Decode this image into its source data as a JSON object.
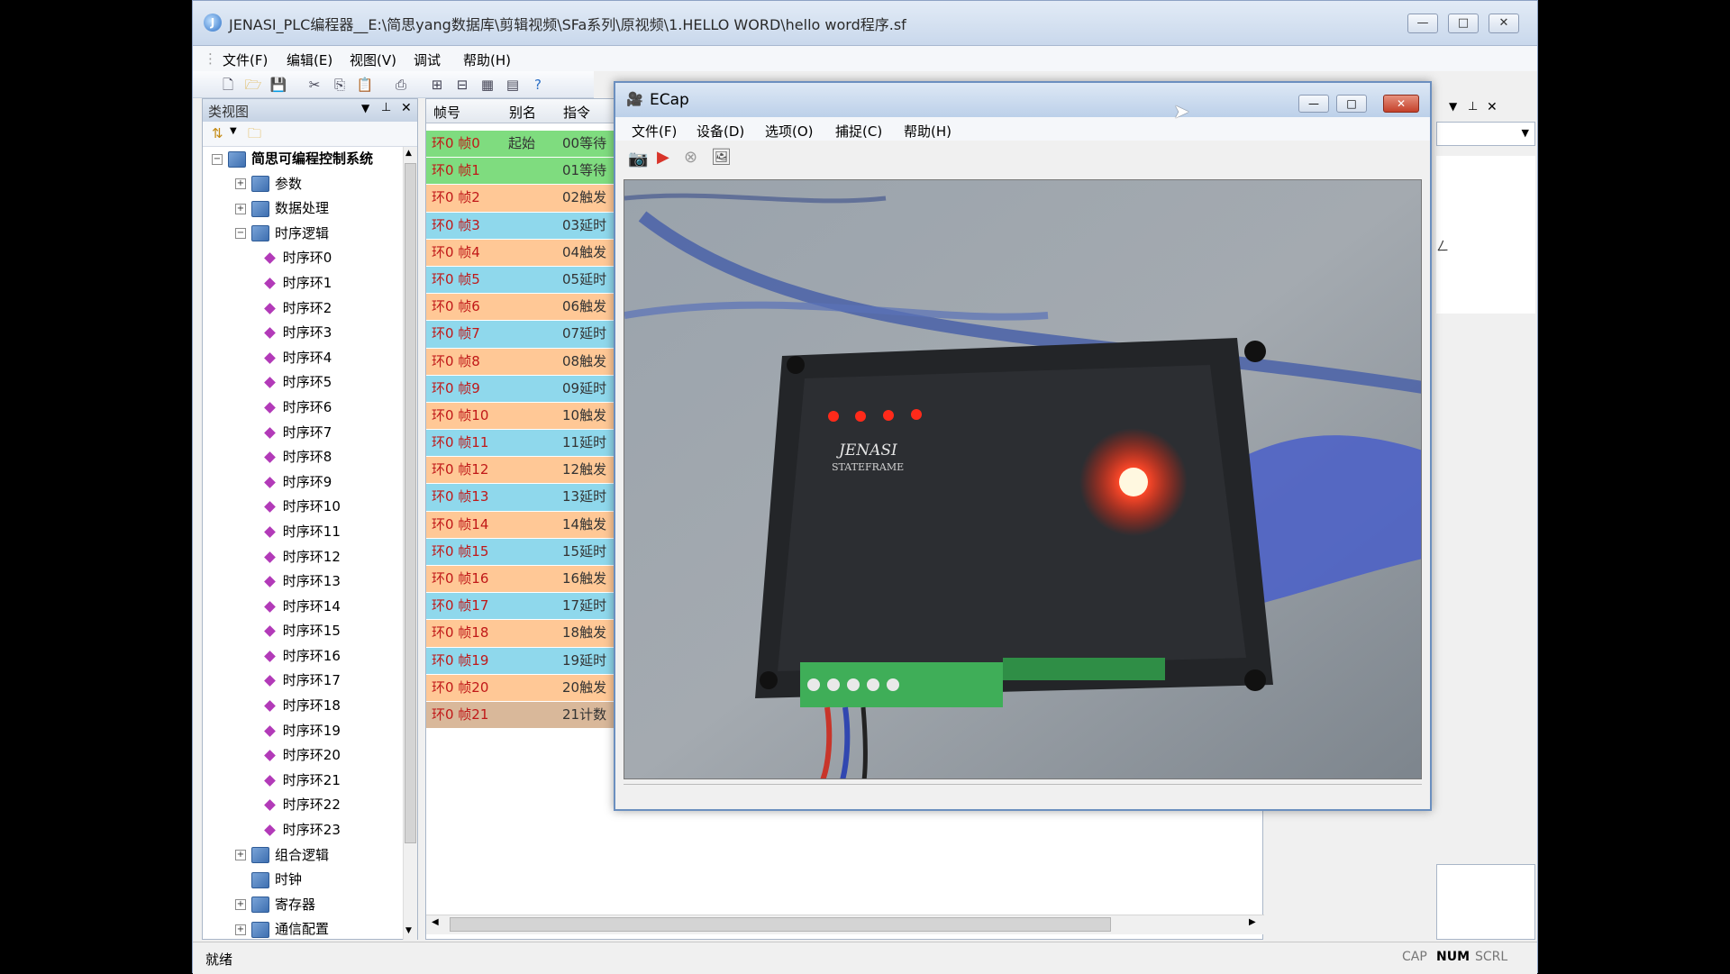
{
  "main_window": {
    "title": "JENASI_PLC编程器__E:\\简思yang数据库\\剪辑视频\\SFa系列\\原视频\\1.HELLO WORD\\hello word程序.sf",
    "menu": [
      "文件(F)",
      "编辑(E)",
      "视图(V)",
      "调试",
      "帮助(H)"
    ]
  },
  "class_view": {
    "title": "类视图",
    "root": "简思可编程控制系统",
    "top_nodes": [
      "参数",
      "数据处理",
      "时序逻辑"
    ],
    "timing_rings": [
      "时序环0",
      "时序环1",
      "时序环2",
      "时序环3",
      "时序环4",
      "时序环5",
      "时序环6",
      "时序环7",
      "时序环8",
      "时序环9",
      "时序环10",
      "时序环11",
      "时序环12",
      "时序环13",
      "时序环14",
      "时序环15",
      "时序环16",
      "时序环17",
      "时序环18",
      "时序环19",
      "时序环20",
      "时序环21",
      "时序环22",
      "时序环23"
    ],
    "bottom_nodes": [
      "组合逻辑",
      "时钟",
      "寄存器",
      "通信配置"
    ]
  },
  "grid": {
    "headers": [
      "帧号",
      "别名",
      "指令"
    ],
    "rows": [
      {
        "frame": "环0 帧0",
        "alias": "起始",
        "instr": "00等待",
        "color": "#7fdc7f"
      },
      {
        "frame": "环0 帧1",
        "alias": "",
        "instr": "01等待",
        "color": "#7fdc7f"
      },
      {
        "frame": "环0 帧2",
        "alias": "",
        "instr": "02触发",
        "color": "#ffc896"
      },
      {
        "frame": "环0 帧3",
        "alias": "",
        "instr": "03延时",
        "color": "#8fd8ec"
      },
      {
        "frame": "环0 帧4",
        "alias": "",
        "instr": "04触发",
        "color": "#ffc896"
      },
      {
        "frame": "环0 帧5",
        "alias": "",
        "instr": "05延时",
        "color": "#8fd8ec"
      },
      {
        "frame": "环0 帧6",
        "alias": "",
        "instr": "06触发",
        "color": "#ffc896"
      },
      {
        "frame": "环0 帧7",
        "alias": "",
        "instr": "07延时",
        "color": "#8fd8ec"
      },
      {
        "frame": "环0 帧8",
        "alias": "",
        "instr": "08触发",
        "color": "#ffc896"
      },
      {
        "frame": "环0 帧9",
        "alias": "",
        "instr": "09延时",
        "color": "#8fd8ec"
      },
      {
        "frame": "环0 帧10",
        "alias": "",
        "instr": "10触发",
        "color": "#ffc896"
      },
      {
        "frame": "环0 帧11",
        "alias": "",
        "instr": "11延时",
        "color": "#8fd8ec"
      },
      {
        "frame": "环0 帧12",
        "alias": "",
        "instr": "12触发",
        "color": "#ffc896"
      },
      {
        "frame": "环0 帧13",
        "alias": "",
        "instr": "13延时",
        "color": "#8fd8ec"
      },
      {
        "frame": "环0 帧14",
        "alias": "",
        "instr": "14触发",
        "color": "#ffc896"
      },
      {
        "frame": "环0 帧15",
        "alias": "",
        "instr": "15延时",
        "color": "#8fd8ec"
      },
      {
        "frame": "环0 帧16",
        "alias": "",
        "instr": "16触发",
        "color": "#ffc896"
      },
      {
        "frame": "环0 帧17",
        "alias": "",
        "instr": "17延时",
        "color": "#8fd8ec"
      },
      {
        "frame": "环0 帧18",
        "alias": "",
        "instr": "18触发",
        "color": "#ffc896"
      },
      {
        "frame": "环0 帧19",
        "alias": "",
        "instr": "19延时",
        "color": "#8fd8ec"
      },
      {
        "frame": "环0 帧20",
        "alias": "",
        "instr": "20触发",
        "color": "#ffc896"
      },
      {
        "frame": "环0 帧21",
        "alias": "",
        "instr": "21计数",
        "color": "#d9b89a"
      }
    ]
  },
  "ecap": {
    "title": "ECap",
    "menu": [
      "文件(F)",
      "设备(D)",
      "选项(O)",
      "捕捉(C)",
      "帮助(H)"
    ],
    "camera": {
      "brand": "JENASI",
      "model": "STATEFRAME"
    }
  },
  "right_panel": {
    "fragment": "ㄥ"
  },
  "status_bar": {
    "text": "就绪",
    "indicators": [
      "CAP",
      "NUM",
      "SCRL"
    ]
  }
}
